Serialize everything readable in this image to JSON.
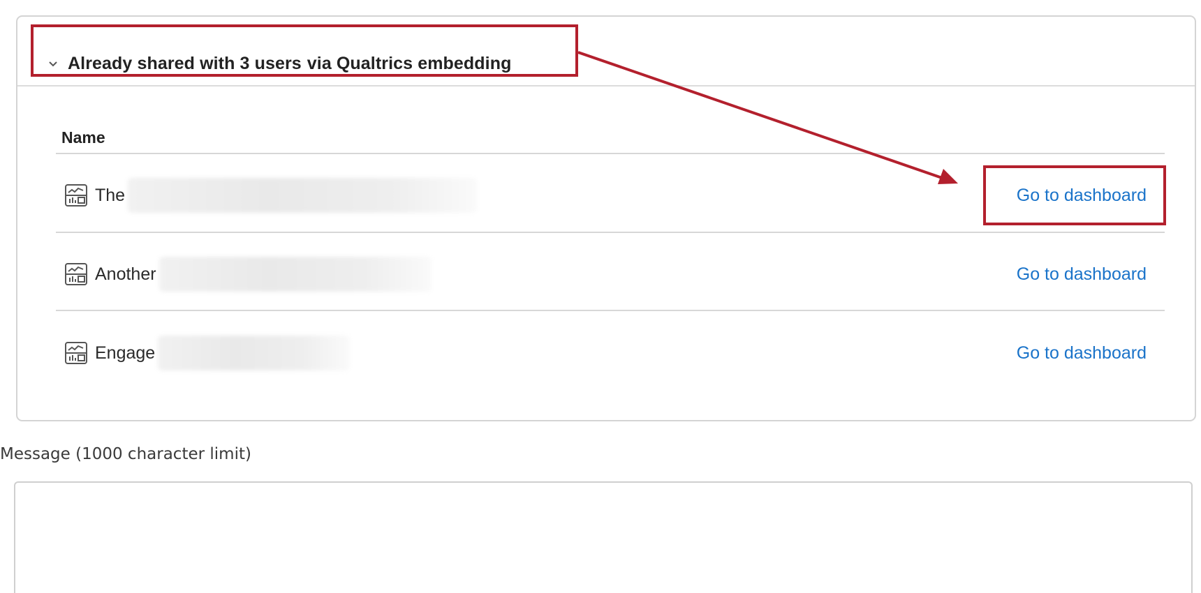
{
  "shared_panel": {
    "toggle_label": "Already shared with 3 users",
    "toggle_sublabel": "via Qualtrics embedding",
    "chevron_icon": "chevron-down-icon",
    "column_header": "Name",
    "rows": [
      {
        "name": "The",
        "icon": "dashboard-icon",
        "action": "Go to dashboard"
      },
      {
        "name": "Another",
        "icon": "dashboard-icon",
        "action": "Go to dashboard"
      },
      {
        "name": "Engage",
        "icon": "dashboard-icon",
        "action": "Go to dashboard"
      }
    ]
  },
  "message": {
    "label": "Message (1000 character limit)",
    "value": ""
  },
  "colors": {
    "annotation": "#b3202d",
    "link": "#1a73c9",
    "border": "#d4d4d4"
  }
}
